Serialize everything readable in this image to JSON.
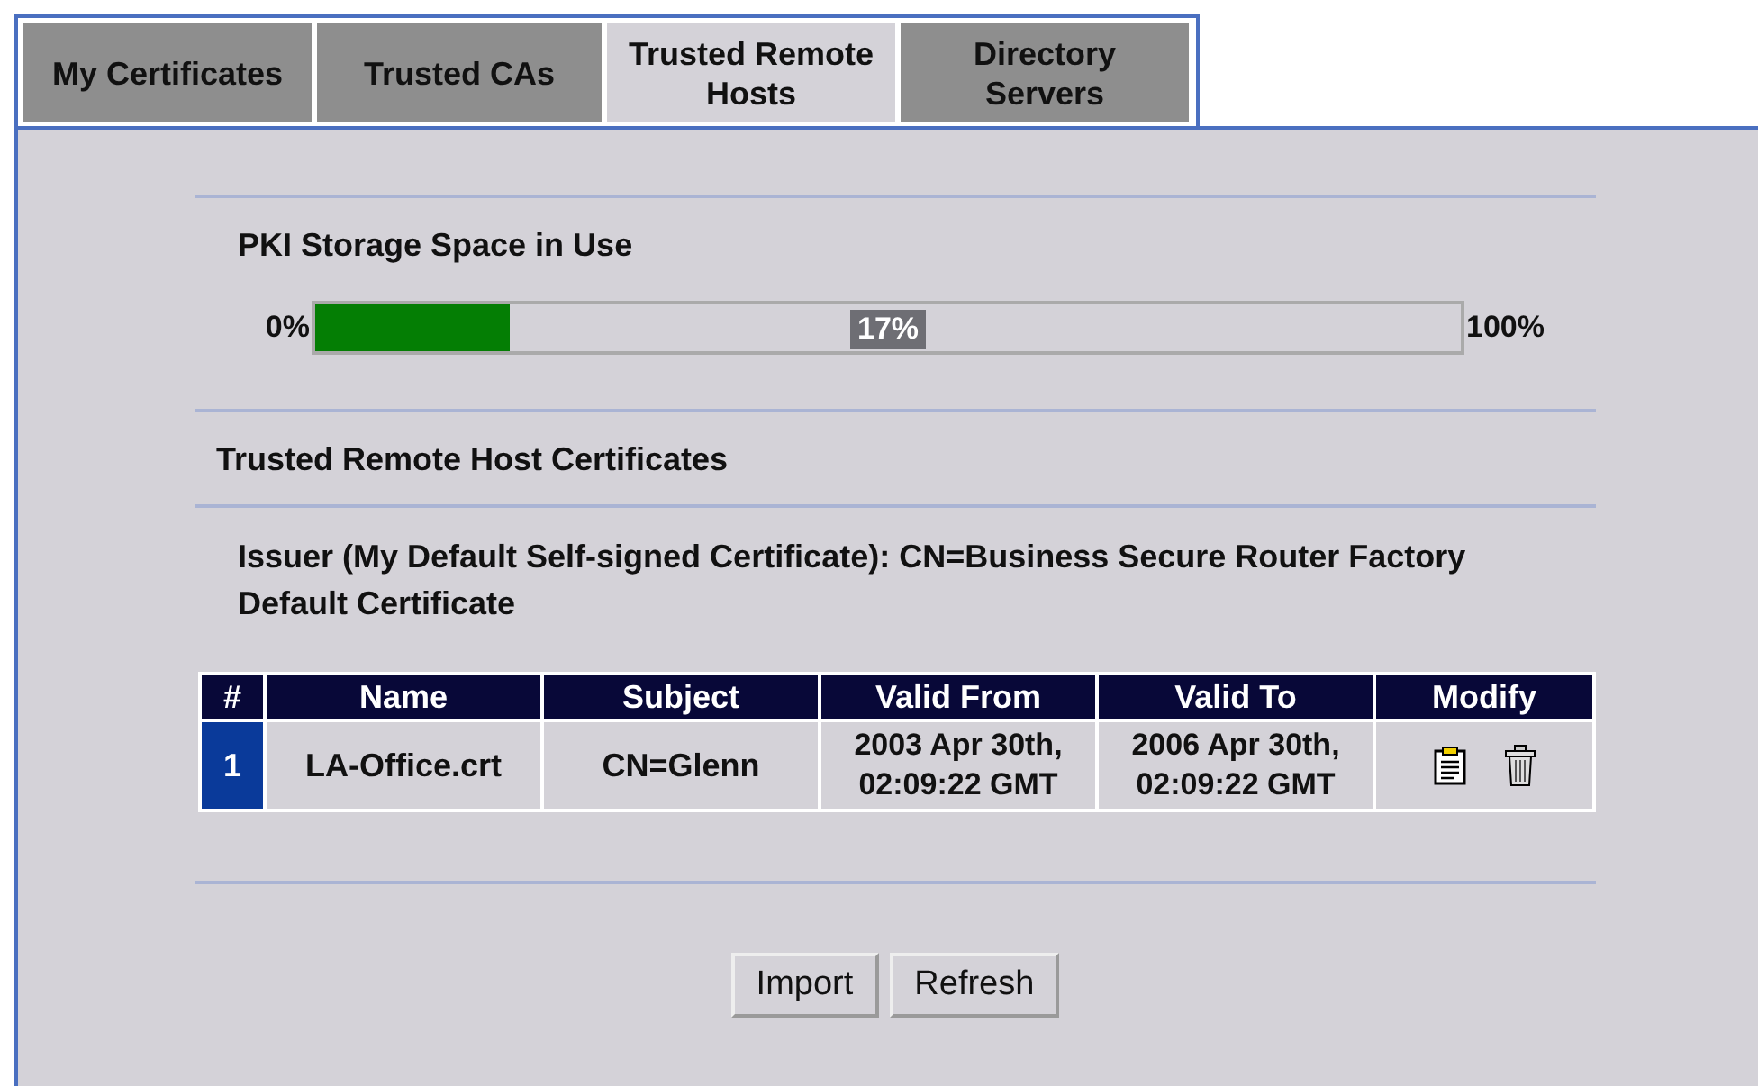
{
  "tabs": [
    {
      "label": "My Certificates",
      "selected": false
    },
    {
      "label": "Trusted CAs",
      "selected": false
    },
    {
      "label": "Trusted Remote Hosts",
      "selected": true
    },
    {
      "label": "Directory Servers",
      "selected": false
    }
  ],
  "storage": {
    "title": "PKI Storage Space in Use",
    "min_label": "0%",
    "max_label": "100%",
    "level": 0.17,
    "reading": "17%"
  },
  "section_title": "Trusted Remote Host Certificates",
  "issuer": "Issuer (My Default Self-signed Certificate): CN=Business Secure Router Factory Default Certificate",
  "table": {
    "columns": [
      "#",
      "Name",
      "Subject",
      "Valid From",
      "Valid To",
      "Modify"
    ],
    "rows": [
      {
        "index": "1",
        "name": "LA-Office.crt",
        "subject": "CN=Glenn",
        "valid_from": "2003 Apr 30th, 02:09:22 GMT",
        "valid_to": "2006 Apr 30th, 02:09:22 GMT"
      }
    ]
  },
  "buttons": [
    "Import",
    "Refresh"
  ]
}
